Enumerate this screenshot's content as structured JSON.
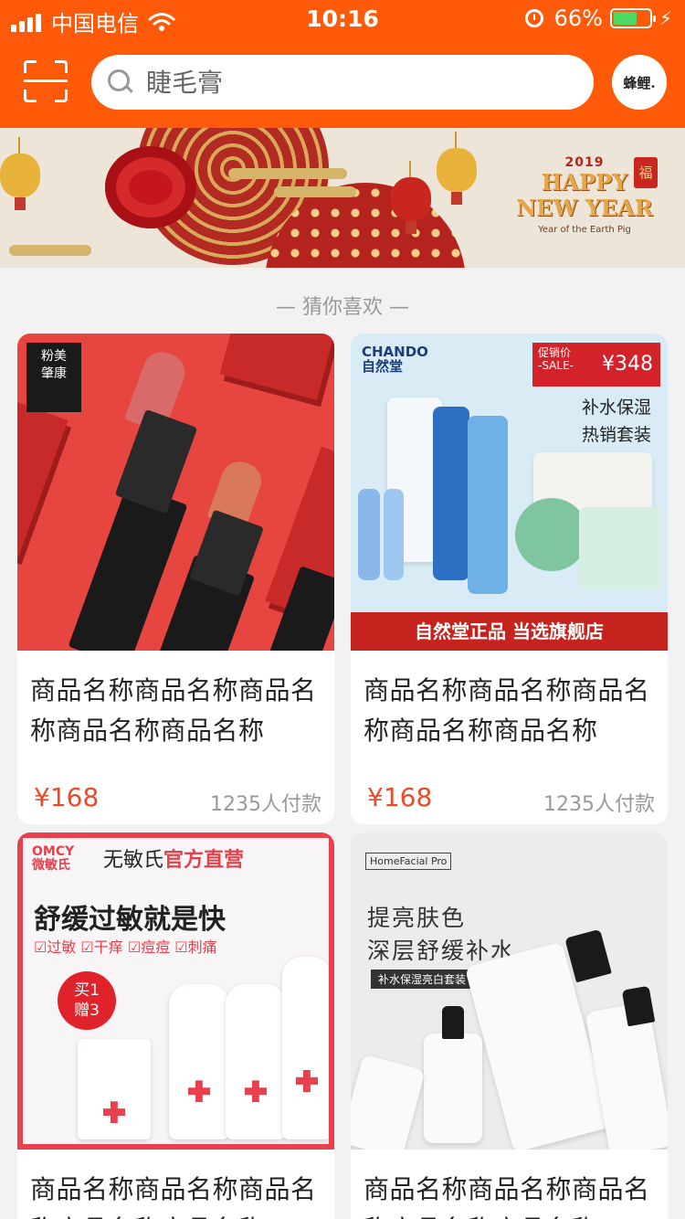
{
  "status_bar": {
    "carrier": "中国电信",
    "time": "10:16",
    "battery_percent": "66%",
    "battery_level": 0.66,
    "battery_color": "#4cd964"
  },
  "header": {
    "scan_icon": "scan-icon",
    "search_placeholder": "睫毛膏",
    "avatar_text": "蜂鲤."
  },
  "banner": {
    "year": "2019",
    "headline_line1": "HAPPY",
    "headline_line2": "NEW YEAR",
    "subtitle": "Year of the Earth Pig",
    "fu_char": "福"
  },
  "section": {
    "title": "— 猜你喜欢 —"
  },
  "products": [
    {
      "image_logo": "粉美\n肇康",
      "name": "商品名称商品名称商品名称商品名称商品名称",
      "price": "¥168",
      "sales": "1235人付款"
    },
    {
      "image_brand": "CHANDO\n自然堂",
      "image_tag_label": "促销价\n-SALE-",
      "image_tag_price": "¥348",
      "image_text": "补水保湿\n热销套装",
      "image_footer": "自然堂正品 当选旗舰店",
      "name": "商品名称商品名称商品名称商品名称商品名称",
      "price": "¥168",
      "sales": "1235人付款"
    },
    {
      "image_brand": "OMCY\n微敏氏",
      "image_official_prefix": "无敏氏",
      "image_official_highlight": "官方直营",
      "image_slogan": "舒缓过敏就是快",
      "image_checks": "☑过敏 ☑干痒 ☑痘痘 ☑刺痛",
      "image_promo": "买1\n赠3",
      "name": "商品名称商品名称商品名称商品名称商品名称",
      "price": "",
      "sales": ""
    },
    {
      "image_brand": "HomeFacial Pro",
      "image_text": "提亮肤色\n深层舒缓补水",
      "image_badge": "补水保湿亮白套装",
      "name": "商品名称商品名称商品名称商品名称商品名称",
      "price": "",
      "sales": ""
    }
  ],
  "colors": {
    "accent": "#ff5a0a",
    "price": "#e94a2a",
    "muted": "#999999"
  }
}
